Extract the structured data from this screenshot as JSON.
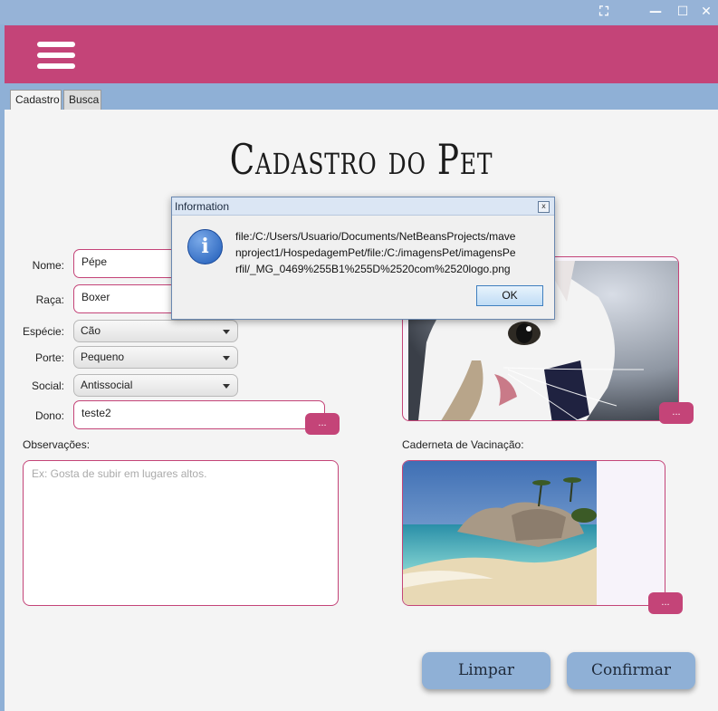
{
  "window": {
    "fullscreen_glyph": "⛶",
    "minimize_glyph": "—",
    "maximize_glyph": "☐",
    "close_glyph": "✕"
  },
  "tabs": [
    {
      "label": "Cadastro",
      "active": true
    },
    {
      "label": "Busca",
      "active": false
    }
  ],
  "page_title": "Cadastro do Pet",
  "form": {
    "nome": {
      "label": "Nome:",
      "value": "Pépe"
    },
    "raca": {
      "label": "Raça:",
      "value": "Boxer"
    },
    "especie": {
      "label": "Espécie:",
      "value": "Cão"
    },
    "porte": {
      "label": "Porte:",
      "value": "Pequeno"
    },
    "social": {
      "label": "Social:",
      "value": "Antissocial"
    },
    "dono": {
      "label": "Dono:",
      "value": "teste2",
      "browse_label": "..."
    },
    "observacoes": {
      "label": "Observações:",
      "placeholder": "Ex: Gosta de subir em lugares altos."
    }
  },
  "photo": {
    "browse_label": "..."
  },
  "caderneta": {
    "label": "Caderneta de Vacinação:",
    "browse_label": "..."
  },
  "buttons": {
    "limpar": "Limpar",
    "confirmar": "Confirmar"
  },
  "dialog": {
    "title": "Information",
    "close_glyph": "x",
    "icon_glyph": "i",
    "message": "file:/C:/Users/Usuario/Documents/NetBeansProjects/mavenproject1/HospedagemPet/file:/C:/imagensPet/imagensPerfil/_MG_0469%255B1%255D%2520com%2520logo.png",
    "ok_label": "OK"
  },
  "colors": {
    "accent": "#c44478",
    "titlebar": "#96b3d7",
    "panel": "#f4f4f4",
    "button": "#8fb0d6"
  }
}
